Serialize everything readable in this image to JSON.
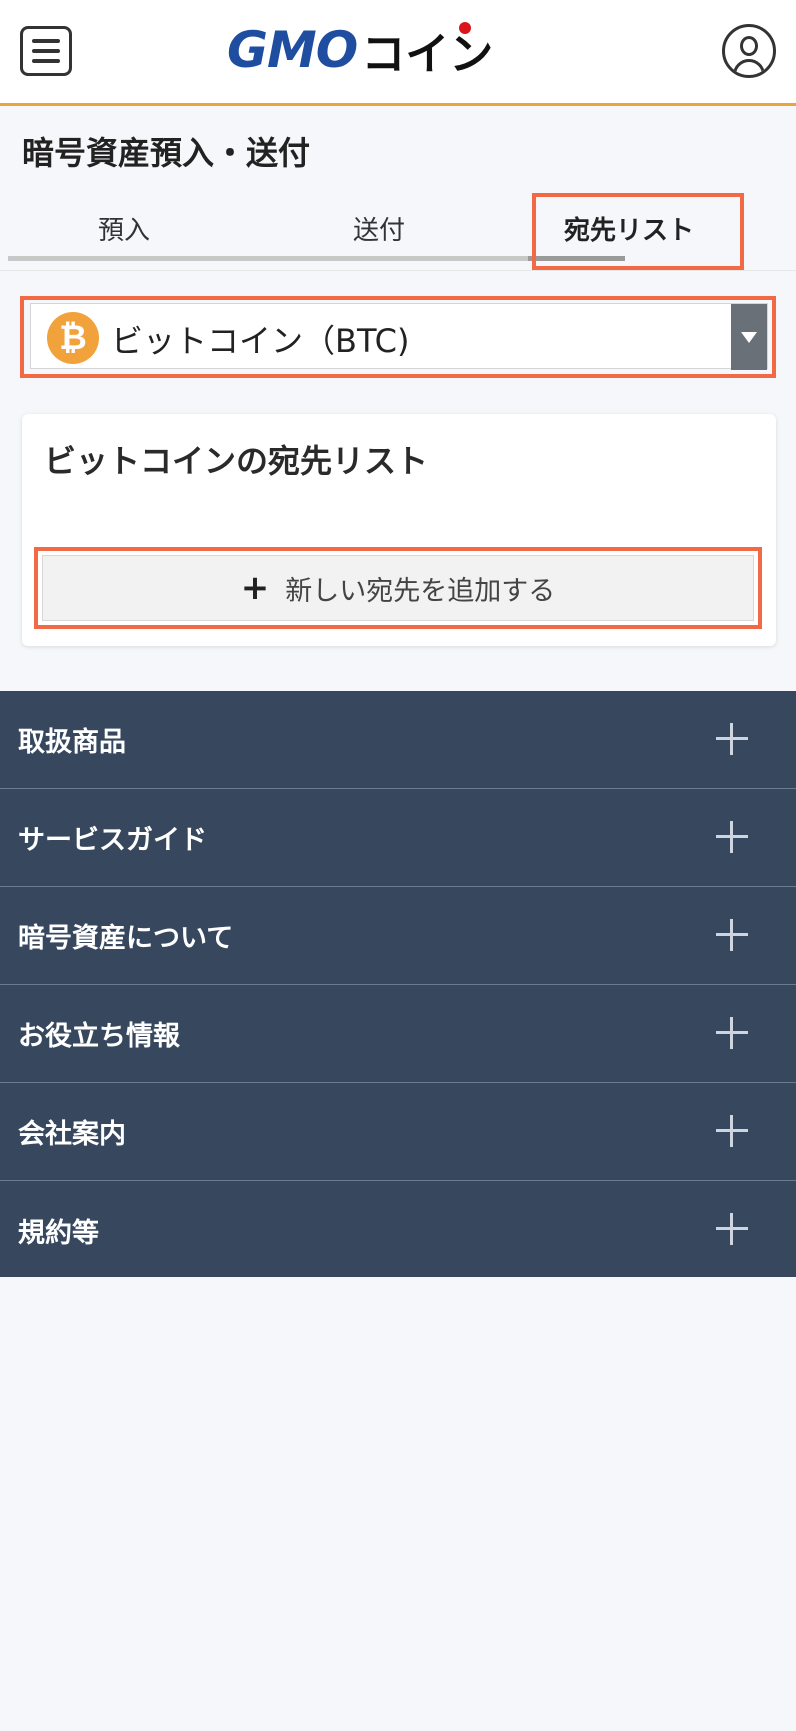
{
  "header": {
    "logo_gmo": "GMO",
    "logo_coin": "コイン"
  },
  "page": {
    "title": "暗号資産預入・送付"
  },
  "tabs": [
    {
      "label": "預入"
    },
    {
      "label": "送付"
    },
    {
      "label": "宛先リスト",
      "active": true
    }
  ],
  "currency_select": {
    "icon_symbol": "₿",
    "value": "ビットコイン（BTC)"
  },
  "address_card": {
    "title": "ビットコインの宛先リスト",
    "add_button_label": "新しい宛先を追加する",
    "add_button_icon": "+"
  },
  "footer_nav": {
    "items": [
      {
        "label": "取扱商品"
      },
      {
        "label": "サービスガイド"
      },
      {
        "label": "暗号資産について"
      },
      {
        "label": "お役立ち情報"
      },
      {
        "label": "会社案内"
      },
      {
        "label": "規約等"
      }
    ]
  },
  "colors": {
    "brand_blue": "#1f4ea1",
    "header_border": "#e8a63a",
    "highlight": "#f26a45",
    "footer_bg": "#36475e",
    "bitcoin": "#f2a23a"
  }
}
